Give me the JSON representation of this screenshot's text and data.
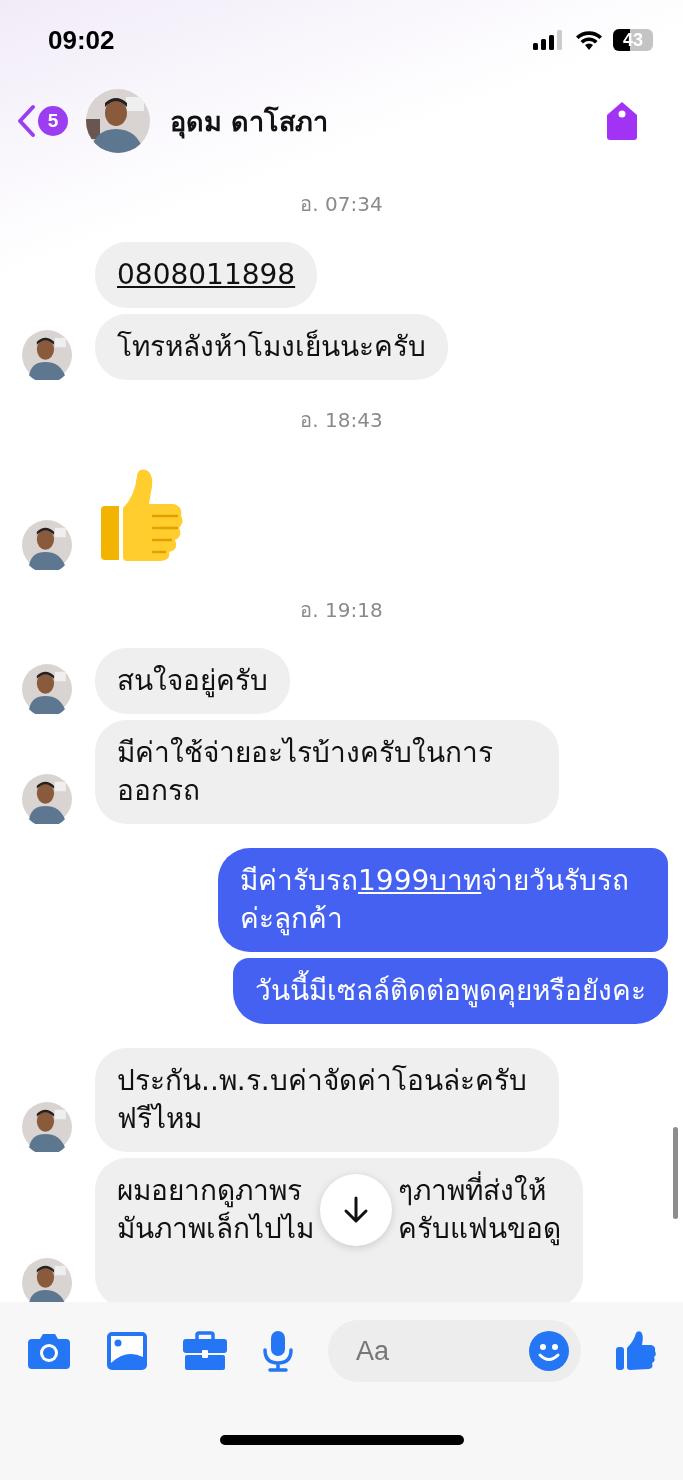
{
  "status_bar": {
    "time": "09:02",
    "battery": "43"
  },
  "header": {
    "back_badge": "5",
    "contact_name": "อุดม ดาโสภา"
  },
  "messages": [
    {
      "kind": "timestamp",
      "text": "อ. 07:34"
    },
    {
      "kind": "text",
      "outgoing": false,
      "avatar": false,
      "parts": [
        {
          "text": "0808011898",
          "link": true
        }
      ]
    },
    {
      "kind": "text",
      "outgoing": false,
      "avatar": true,
      "parts": [
        {
          "text": "โทรหลังห้าโมงเย็นนะครับ",
          "link": false
        }
      ]
    },
    {
      "kind": "timestamp",
      "text": "อ. 18:43"
    },
    {
      "kind": "like",
      "outgoing": false,
      "avatar": true
    },
    {
      "kind": "timestamp",
      "text": "อ. 19:18"
    },
    {
      "kind": "text",
      "outgoing": false,
      "avatar": true,
      "parts": [
        {
          "text": "สนใจอยู่ครับ",
          "link": false
        }
      ]
    },
    {
      "kind": "text",
      "outgoing": false,
      "avatar": true,
      "parts": [
        {
          "text": "มีค่าใช้จ่ายอะไรบ้างครับในการออกรถ",
          "link": false
        }
      ]
    },
    {
      "kind": "text",
      "outgoing": true,
      "avatar": false,
      "parts": [
        {
          "text": "มีค่ารับรถ",
          "link": false
        },
        {
          "text": "1999บาท",
          "link": true
        },
        {
          "text": "จ่ายวันรับรถค่ะลูกค้า",
          "link": false
        }
      ]
    },
    {
      "kind": "text",
      "outgoing": true,
      "avatar": false,
      "parts": [
        {
          "text": "วันนี้มีเซลล์ติดต่อพูดคุยหรือยังคะ",
          "link": false
        }
      ]
    },
    {
      "kind": "text",
      "outgoing": false,
      "avatar": true,
      "parts": [
        {
          "text": "ประกัน..พ.ร.บค่าจัดค่าโอนล่ะครับฟรีไหม",
          "link": false
        }
      ]
    },
    {
      "kind": "covered",
      "outgoing": false,
      "avatar": true,
      "lines": [
        [
          "ผมอยากดูภาพร",
          "ๆภาพที่ส่งให้"
        ],
        [
          "มันภาพเล็กไปไม",
          "ครับแฟนขอดู"
        ]
      ]
    }
  ],
  "composer": {
    "placeholder": "Aa"
  }
}
